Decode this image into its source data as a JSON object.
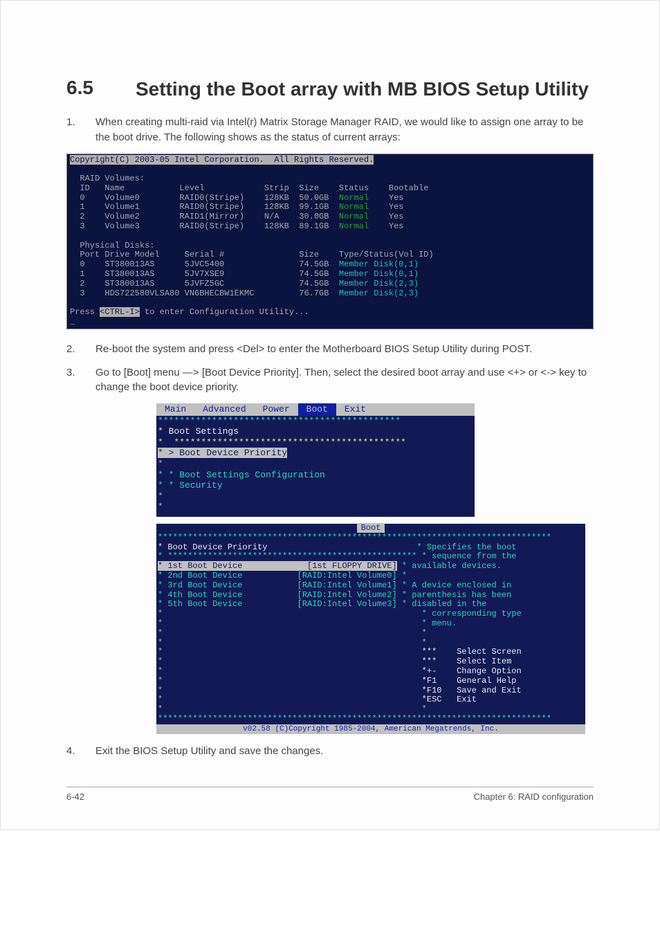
{
  "heading": {
    "num": "6.5",
    "title": "Setting the Boot array with MB BIOS Setup Utility"
  },
  "step1": {
    "num": "1.",
    "text": "When creating multi-raid via Intel(r) Matrix Storage Manager RAID, we would like to assign one array to be the boot drive. The following shows as the status of current arrays:"
  },
  "raid": {
    "copyright": "Copyright(C) 2003-05 Intel Corporation.  All Rights Reserved.",
    "vol_header": "  RAID Volumes:",
    "vol_cols": "  ID   Name           Level            Strip  Size    Status    Bootable",
    "vol_rows": [
      {
        "left": "  0    Volume0        RAID0(Stripe)    128KB  50.0GB  ",
        "status": "Normal",
        "boot": "    Yes"
      },
      {
        "left": "  1    Volume1        RAID0(Stripe)    128KB  99.1GB  ",
        "status": "Normal",
        "boot": "    Yes"
      },
      {
        "left": "  2    Volume2        RAID1(Mirror)    N/A    30.0GB  ",
        "status": "Normal",
        "boot": "    Yes"
      },
      {
        "left": "  3    Volume3        RAID0(Stripe)    128KB  89.1GB  ",
        "status": "Normal",
        "boot": "    Yes"
      }
    ],
    "phys_header": "  Physical Disks:",
    "phys_cols": "  Port Drive Model     Serial #               Size    Type/Status(Vol ID)",
    "phys_rows": [
      {
        "left": "  0    ST380013AS      5JVC5400               74.5GB  ",
        "right": "Member Disk(0,1)"
      },
      {
        "left": "  1    ST380013AS      5JV7XSE9               74.5GB  ",
        "right": "Member Disk(0,1)"
      },
      {
        "left": "  2    ST380013AS      5JVFZ5GC               74.5GB  ",
        "right": "Member Disk(2,3)"
      },
      {
        "left": "  3    HDS722580VLSA80 VN6BHECBW1EKMC         76.7GB  ",
        "right": "Member Disk(2,3)"
      }
    ],
    "press_pre": "Press ",
    "press_key": "<CTRL-I>",
    "press_post": " to enter Configuration Utility..."
  },
  "step2": {
    "num": "2.",
    "text": "Re-boot the system and press <Del> to enter the Motherboard BIOS Setup Utility during POST."
  },
  "step3": {
    "num": "3.",
    "text": "Go to [Boot] menu —> [Boot Device Priority]. Then, select the desired boot array and use <+> or <-> key to change the boot device priority."
  },
  "bios1": {
    "tabs": {
      "main": "Main",
      "advanced": "Advanced",
      "power": "Power",
      "boot": "Boot",
      "exit": "Exit"
    },
    "divider": "*********************************************",
    "title": "* Boot Settings",
    "submenu_sel": "* > Boot Device Priority",
    "item_cfg": "* * Boot Settings Configuration",
    "item_sec": "* * Security"
  },
  "bios2": {
    "tab": "Boot",
    "hdr_left": "* Boot Device Priority",
    "rows": [
      {
        "label": "* 1st Boot Device",
        "value": "[1st FLOPPY DRIVE]",
        "sel": true
      },
      {
        "label": "* 2nd Boot Device",
        "value": "[RAID:Intel Volume0]",
        "sel": false
      },
      {
        "label": "* 3rd Boot Device",
        "value": "[RAID:Intel Volume1]",
        "sel": false
      },
      {
        "label": "* 4th Boot Device",
        "value": "[RAID:Intel Volume2]",
        "sel": false
      },
      {
        "label": "* 5th Boot Device",
        "value": "[RAID:Intel Volume3]",
        "sel": false
      }
    ],
    "help": [
      "* Specifies the boot",
      "* sequence from the",
      "* available devices.",
      "*",
      "* A device enclosed in",
      "* parenthesis has been",
      "* disabled in the",
      "* corresponding type",
      "* menu."
    ],
    "keys": [
      {
        "k": "***",
        "d": "Select Screen"
      },
      {
        "k": "***",
        "d": "Select Item"
      },
      {
        "k": "*+-",
        "d": "Change Option"
      },
      {
        "k": "*F1",
        "d": "General Help"
      },
      {
        "k": "*F10",
        "d": "Save and Exit"
      },
      {
        "k": "*ESC",
        "d": "Exit"
      }
    ],
    "footer": "v02.58 (C)Copyright 1985-2004, American Megatrends, Inc."
  },
  "step4": {
    "num": "4.",
    "text": "Exit the BIOS Setup Utility and save the changes."
  },
  "footer": {
    "left": "6-42",
    "right": "Chapter 6: RAID configuration"
  }
}
